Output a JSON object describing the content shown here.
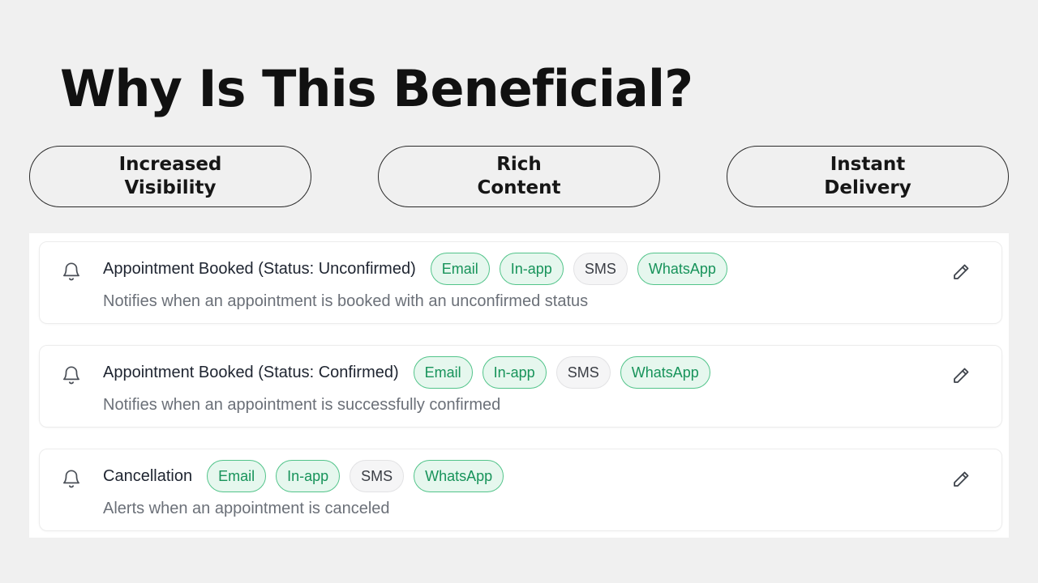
{
  "title": "Why Is This Beneficial?",
  "benefits": [
    {
      "label": "Increased Visibility"
    },
    {
      "label": "Rich Content"
    },
    {
      "label": "Instant Delivery"
    }
  ],
  "notifications": [
    {
      "title": "Appointment Booked (Status: Unconfirmed)",
      "description": "Notifies when an appointment is booked with an unconfirmed status",
      "channels": [
        {
          "label": "Email",
          "enabled": true
        },
        {
          "label": "In-app",
          "enabled": true
        },
        {
          "label": "SMS",
          "enabled": false
        },
        {
          "label": "WhatsApp",
          "enabled": true
        }
      ]
    },
    {
      "title": "Appointment Booked (Status: Confirmed)",
      "description": "Notifies when an appointment is successfully confirmed",
      "channels": [
        {
          "label": "Email",
          "enabled": true
        },
        {
          "label": "In-app",
          "enabled": true
        },
        {
          "label": "SMS",
          "enabled": false
        },
        {
          "label": "WhatsApp",
          "enabled": true
        }
      ]
    },
    {
      "title": "Cancellation",
      "description": "Alerts when an appointment is canceled",
      "channels": [
        {
          "label": "Email",
          "enabled": true
        },
        {
          "label": "In-app",
          "enabled": true
        },
        {
          "label": "SMS",
          "enabled": false
        },
        {
          "label": "WhatsApp",
          "enabled": true
        }
      ]
    }
  ],
  "icons": {
    "row": "bell-icon",
    "action": "pencil-edit-icon"
  },
  "colors": {
    "background": "#f0f0f0",
    "enabled_tag_bg": "#e6f7ee",
    "enabled_tag_border": "#52c48a",
    "enabled_tag_text": "#17935a",
    "disabled_tag_bg": "#f5f5f6",
    "disabled_tag_text": "#3a3d44"
  }
}
